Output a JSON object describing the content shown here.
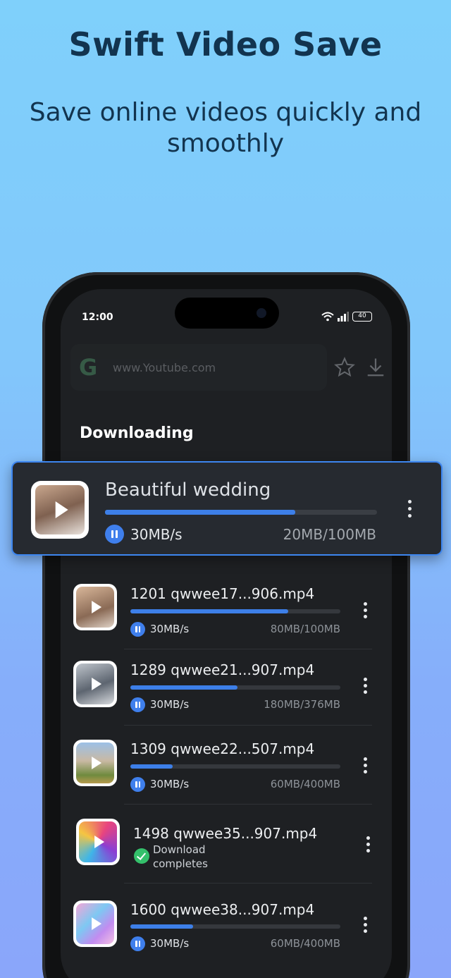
{
  "promo": {
    "headline": "Swift Video Save",
    "subheadline": "Save online videos quickly and smoothly"
  },
  "status_bar": {
    "time": "12:00",
    "battery": "40",
    "icons": [
      "wifi-icon",
      "signal-icon",
      "battery-icon"
    ]
  },
  "browser": {
    "url": "www.Youtube.com",
    "search_logo": "G",
    "actions": [
      "star-icon",
      "download-icon"
    ]
  },
  "section_title": "Downloading",
  "featured_download": {
    "title": "Beautiful wedding",
    "speed": "30MB/s",
    "size": "20MB/100MB",
    "progress": 0.7
  },
  "downloads": [
    {
      "title": "1201 qwwee17...906.mp4",
      "speed": "30MB/s",
      "size": "80MB/100MB",
      "progress": 0.75,
      "status": "downloading"
    },
    {
      "title": "1289 qwwee21...907.mp4",
      "speed": "30MB/s",
      "size": "180MB/376MB",
      "progress": 0.51,
      "status": "downloading"
    },
    {
      "title": "1309 qwwee22...507.mp4",
      "speed": "30MB/s",
      "size": "60MB/400MB",
      "progress": 0.2,
      "status": "downloading"
    },
    {
      "title": "1498 qwwee35...907.mp4",
      "status": "complete",
      "status_text": "Download completes"
    },
    {
      "title": "1600 qwwee38...907.mp4",
      "speed": "30MB/s",
      "size": "60MB/400MB",
      "progress": 0.3,
      "status": "downloading"
    }
  ],
  "colors": {
    "accent": "#3d7fe8",
    "complete": "#34c06b",
    "card_border": "#3d86f0"
  }
}
